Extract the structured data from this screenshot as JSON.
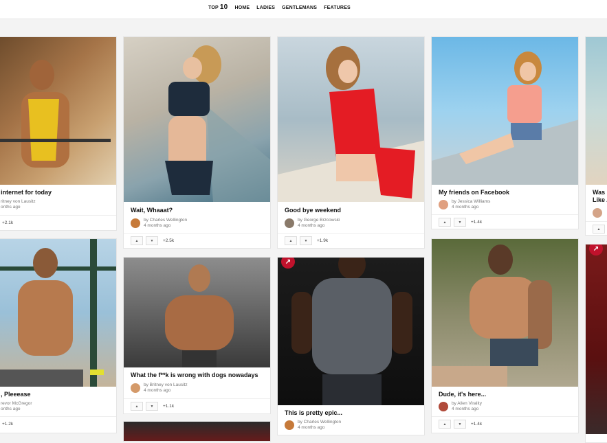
{
  "nav": {
    "top10_prefix": "TOP",
    "top10_num": "10",
    "home": "HOME",
    "ladies": "LADIES",
    "gentlemans": "GENTLEMANS",
    "features": "FEATURES"
  },
  "cards": [
    {
      "title": "internet for today",
      "author": "ritney von Lausitz",
      "time": "onths ago",
      "score": "+2.1k"
    },
    {
      "title": "Wait, Whaaat?",
      "author": "by Charles Wellington",
      "time": "4 months ago",
      "score": "+2.5k"
    },
    {
      "title": "Good bye weekend",
      "author": "by George Brzcowski",
      "time": "4 months ago",
      "score": "+1.9k"
    },
    {
      "title": "My friends on Facebook",
      "author": "by Jessica Williams",
      "time": "4 months ago",
      "score": "+1.4k"
    },
    {
      "title": "Was",
      "title2": "Like A",
      "score": ""
    },
    {
      "title": ", Pleeease",
      "author": "revor McGregor",
      "time": "onths ago",
      "score": "+1.2k"
    },
    {
      "title": "What the f**k is wrong with dogs nowadays",
      "author": "by Britney von Lausitz",
      "time": "4 months ago",
      "score": "+1.1k"
    },
    {
      "title": "This is pretty epic...",
      "author": "by Charles Wellington",
      "time": "4 months ago",
      "score": ""
    },
    {
      "title": "Dude, it's here...",
      "author": "by Allen Virality",
      "time": "4 months ago",
      "score": "+1.4k"
    }
  ],
  "icons": {
    "up": "up-arrow-icon",
    "down": "down-arrow-icon",
    "trending": "trending-icon"
  },
  "colors": {
    "accent": "#c0122c"
  }
}
